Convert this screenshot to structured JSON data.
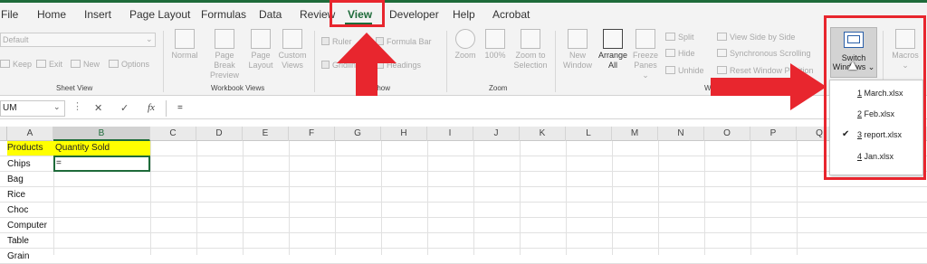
{
  "tabs": [
    "File",
    "Home",
    "Insert",
    "Page Layout",
    "Formulas",
    "Data",
    "Review",
    "View",
    "Developer",
    "Help",
    "Acrobat"
  ],
  "active_tab": "View",
  "ribbon": {
    "sheet_view": {
      "group_label": "Sheet View",
      "default_value": "Default",
      "keep": "Keep",
      "exit": "Exit",
      "new": "New",
      "options": "Options"
    },
    "workbook_views": {
      "group_label": "Workbook Views",
      "normal": "Normal",
      "page_break_line1": "Page Break",
      "page_break_line2": "Preview",
      "page_layout_line1": "Page",
      "page_layout_line2": "Layout",
      "custom_line1": "Custom",
      "custom_line2": "Views"
    },
    "show": {
      "group_label": "Show",
      "ruler": "Ruler",
      "formula_bar": "Formula Bar",
      "gridlines": "Gridlines",
      "headings": "Headings"
    },
    "zoom": {
      "group_label": "Zoom",
      "zoom": "Zoom",
      "hundred": "100%",
      "zoom_sel_line1": "Zoom to",
      "zoom_sel_line2": "Selection"
    },
    "window": {
      "group_label": "Window",
      "new_line1": "New",
      "new_line2": "Window",
      "arrange_line1": "Arrange",
      "arrange_line2": "All",
      "freeze_line1": "Freeze",
      "freeze_line2": "Panes",
      "split": "Split",
      "hide": "Hide",
      "unhide": "Unhide",
      "side_by_side": "View Side by Side",
      "sync_scroll": "Synchronous Scrolling",
      "reset_pos": "Reset Window Position",
      "switch_line1": "Switch",
      "switch_line2": "Windows"
    },
    "macros": {
      "label": "Macros"
    }
  },
  "formula_bar": {
    "name_box": "UM",
    "cancel": "✕",
    "enter": "✓",
    "fx": "fx",
    "content": "="
  },
  "columns": [
    "A",
    "B",
    "C",
    "D",
    "E",
    "F",
    "G",
    "H",
    "I",
    "J",
    "K",
    "L",
    "M",
    "N",
    "O",
    "P",
    "Q"
  ],
  "cells": {
    "A1": "Products",
    "B1": "Quantity Sold",
    "B2": "=",
    "A_col": [
      "Chips",
      "Bag",
      "Rice",
      "Choc",
      "Computer",
      "Table",
      "Grain"
    ]
  },
  "switch_windows_menu": [
    {
      "num": "1",
      "name": "March.xlsx",
      "checked": false
    },
    {
      "num": "2",
      "name": "Feb.xlsx",
      "checked": false
    },
    {
      "num": "3",
      "name": "report.xlsx",
      "checked": true
    },
    {
      "num": "4",
      "name": "Jan.xlsx",
      "checked": false
    }
  ],
  "colors": {
    "accent_red": "#e8262e",
    "header_yellow": "#ffff00",
    "excel_green": "#1e6b3a"
  }
}
